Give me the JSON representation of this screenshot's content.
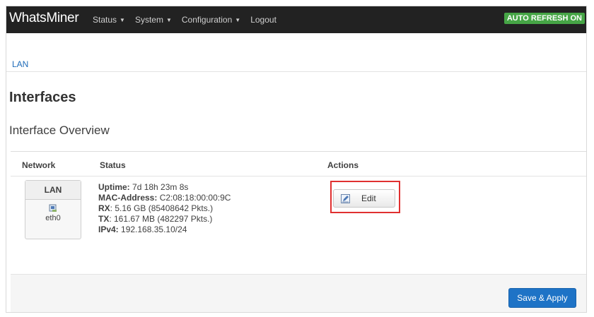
{
  "navbar": {
    "brand": "WhatsMiner",
    "menu": [
      {
        "label": "Status",
        "has_dropdown": true
      },
      {
        "label": "System",
        "has_dropdown": true
      },
      {
        "label": "Configuration",
        "has_dropdown": true
      },
      {
        "label": "Logout",
        "has_dropdown": false
      }
    ],
    "auto_refresh": "AUTO REFRESH ON"
  },
  "tabs": [
    {
      "label": "LAN",
      "active": true
    }
  ],
  "page_title": "Interfaces",
  "section_title": "Interface Overview",
  "table": {
    "headers": {
      "network": "Network",
      "status": "Status",
      "actions": "Actions"
    },
    "rows": [
      {
        "network": {
          "name": "LAN",
          "device": "eth0"
        },
        "status": {
          "uptime_label": "Uptime:",
          "uptime_value": "7d 18h 23m 8s",
          "mac_label": "MAC-Address:",
          "mac_value": "C2:08:18:00:00:9C",
          "rx_label": "RX",
          "rx_value": ": 5.16 GB (85408642 Pkts.)",
          "tx_label": "TX",
          "tx_value": ": 161.67 MB (482297 Pkts.)",
          "ipv4_label": "IPv4:",
          "ipv4_value": "192.168.35.10/24"
        },
        "action_label": "Edit"
      }
    ]
  },
  "footer": {
    "save_apply": "Save & Apply"
  },
  "colors": {
    "navbar_bg": "#222222",
    "auto_refresh_bg": "#46a546",
    "link": "#1e6bb8",
    "primary_button": "#1e73c6",
    "highlight": "#e03030"
  }
}
